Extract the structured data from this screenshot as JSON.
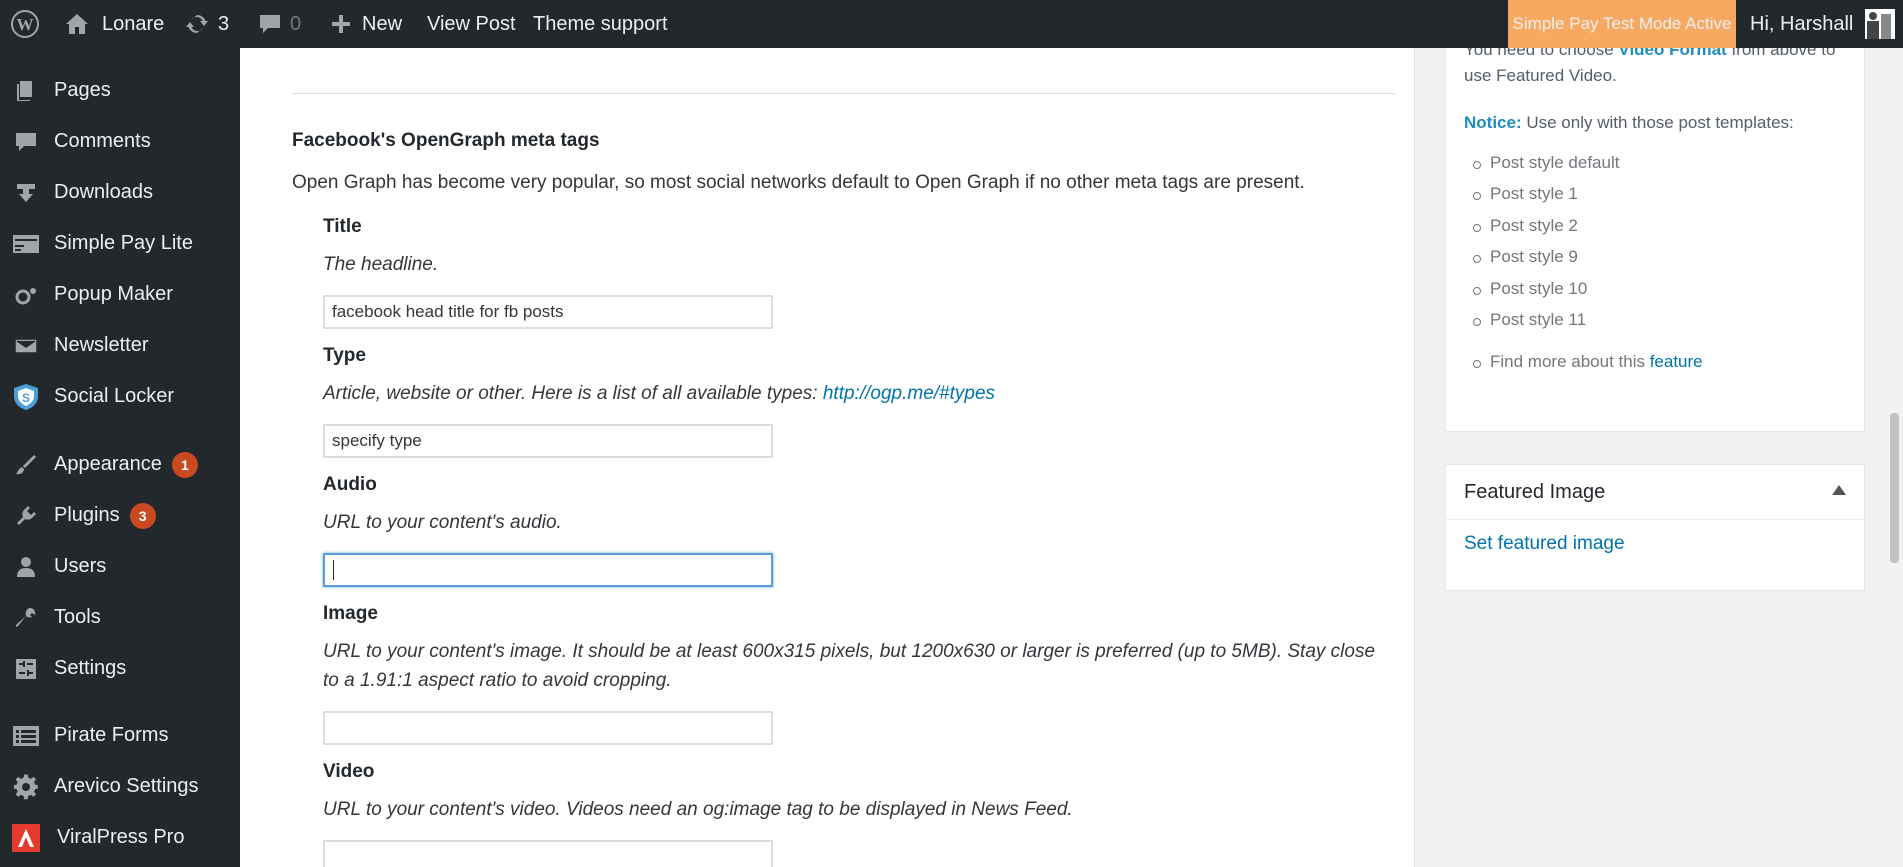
{
  "adminbar": {
    "site_name": "Lonare",
    "updates_count": "3",
    "comments_count": "0",
    "new_label": "New",
    "view_post_label": "View Post",
    "theme_support_label": "Theme support",
    "test_mode_label": "Simple Pay Test Mode Active",
    "greeting": "Hi, Harshall"
  },
  "sidebar": {
    "items": [
      {
        "label": "Pages",
        "icon": "pages-icon"
      },
      {
        "label": "Comments",
        "icon": "comments-icon"
      },
      {
        "label": "Downloads",
        "icon": "downloads-icon"
      },
      {
        "label": "Simple Pay Lite",
        "icon": "simple-pay-icon"
      },
      {
        "label": "Popup Maker",
        "icon": "popup-maker-icon"
      },
      {
        "label": "Newsletter",
        "icon": "envelope-icon"
      },
      {
        "label": "Social Locker",
        "icon": "shield-icon"
      },
      {
        "label": "Appearance",
        "icon": "paintbrush-icon",
        "badge": "1"
      },
      {
        "label": "Plugins",
        "icon": "plugin-icon",
        "badge": "3"
      },
      {
        "label": "Users",
        "icon": "user-icon"
      },
      {
        "label": "Tools",
        "icon": "wrench-icon"
      },
      {
        "label": "Settings",
        "icon": "settings-icon"
      },
      {
        "label": "Pirate Forms",
        "icon": "forms-icon"
      },
      {
        "label": "Arevico Settings",
        "icon": "gear-icon"
      },
      {
        "label": "ViralPress Pro",
        "icon": "viralpress-icon"
      }
    ]
  },
  "opengraph": {
    "title": "Facebook's OpenGraph meta tags",
    "description": "Open Graph has become very popular, so most social networks default to Open Graph if no other meta tags are present.",
    "fields": {
      "title": {
        "label": "Title",
        "help": "The headline.",
        "value": "facebook head title for fb posts"
      },
      "type": {
        "label": "Type",
        "help": "Article, website or other. Here is a list of all available types: ",
        "link": "http://ogp.me/#types",
        "value": "specify type"
      },
      "audio": {
        "label": "Audio",
        "help": "URL to your content's audio.",
        "value": ""
      },
      "image": {
        "label": "Image",
        "help": "URL to your content's image. It should be at least 600x315 pixels, but 1200x630 or larger is preferred (up to 5MB). Stay close to a 1.91:1 aspect ratio to avoid cropping.",
        "value": ""
      },
      "video": {
        "label": "Video",
        "help": "URL to your content's video. Videos need an og:image tag to be displayed in News Feed.",
        "value": ""
      }
    }
  },
  "video_box": {
    "text_pre": "You need to choose ",
    "text_bold": "Video Format",
    "text_post": " from above to use Featured Video.",
    "notice_label": "Notice:",
    "notice_text": " Use only with those post templates:",
    "templates": [
      "Post style default",
      "Post style 1",
      "Post style 2",
      "Post style 9",
      "Post style 10",
      "Post style 11"
    ],
    "find_more_text": "Find more about this ",
    "find_more_link": "feature"
  },
  "featured_image": {
    "title": "Featured Image",
    "link": "Set featured image"
  },
  "colors": {
    "admin_bar": "#23282d",
    "test_mode": "#f7a861",
    "badge": "#ca4a1f",
    "link": "#0073aa"
  }
}
